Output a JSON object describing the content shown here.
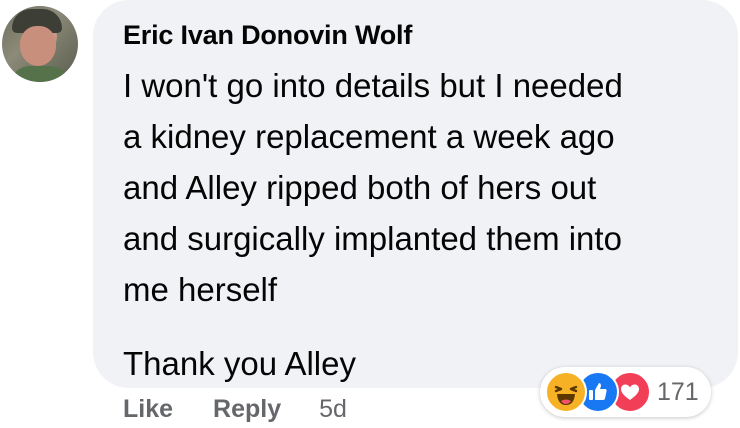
{
  "comment": {
    "author": "Eric Ivan Donovin Wolf",
    "lines": [
      "I won't go into details but I needed",
      "a kidney replacement a week ago",
      "and Alley ripped both of hers out",
      "and surgically implanted them into",
      "me herself"
    ],
    "closing": "Thank you Alley",
    "actions": {
      "like_label": "Like",
      "reply_label": "Reply",
      "timestamp": "5d"
    },
    "reactions": {
      "icons": [
        "haha-icon",
        "like-icon",
        "love-icon"
      ],
      "count": "171"
    }
  },
  "colors": {
    "bubble": "#f0f2f5",
    "secondary_text": "#65676b",
    "like_blue": "#1877f2",
    "love_red": "#f33e58",
    "haha_yellow": "#f7b125"
  }
}
